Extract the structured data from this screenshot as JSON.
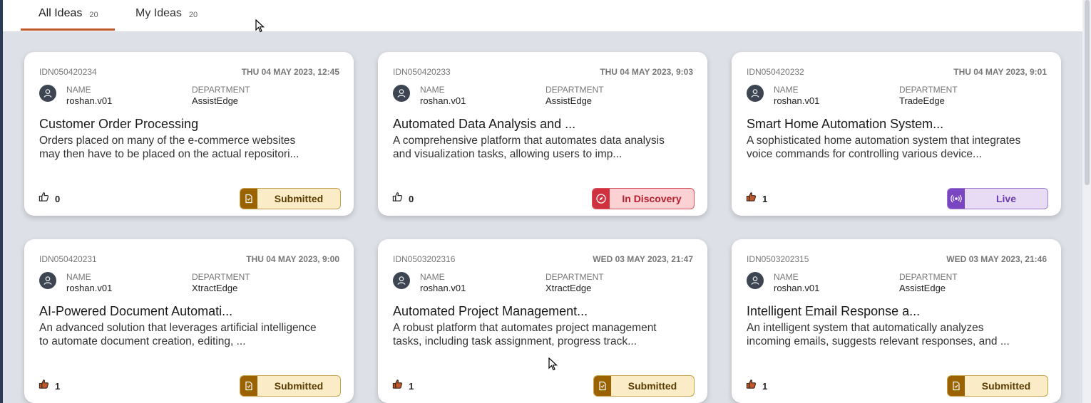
{
  "tabs": [
    {
      "label": "All Ideas",
      "count": "20",
      "active": true
    },
    {
      "label": "My Ideas",
      "count": "20",
      "active": false
    }
  ],
  "labels": {
    "name": "NAME",
    "department": "DEPARTMENT"
  },
  "cards": [
    {
      "id": "IDN050420234",
      "date": "THU 04 MAY 2023, 12:45",
      "name": "roshan.v01",
      "department": "AssistEdge",
      "title": "Customer Order Processing",
      "desc1": "Orders placed on many of the e-commerce websites",
      "desc2": "may then have to be placed on the actual repositori...",
      "likes": "0",
      "liked": false,
      "status": "Submitted",
      "status_type": "submitted"
    },
    {
      "id": "IDN050420233",
      "date": "THU 04 MAY 2023, 9:03",
      "name": "roshan.v01",
      "department": "AssistEdge",
      "title": "Automated Data Analysis and ...",
      "desc1": "A comprehensive platform that automates data analysis",
      "desc2": "and visualization tasks, allowing users to imp...",
      "likes": "0",
      "liked": false,
      "status": "In Discovery",
      "status_type": "discovery"
    },
    {
      "id": "IDN050420232",
      "date": "THU 04 MAY 2023, 9:01",
      "name": "roshan.v01",
      "department": "TradeEdge",
      "title": "Smart Home Automation System...",
      "desc1": "A sophisticated home automation system that integrates",
      "desc2": "voice commands for controlling various device...",
      "likes": "1",
      "liked": true,
      "status": "Live",
      "status_type": "live"
    },
    {
      "id": "IDN050420231",
      "date": "THU 04 MAY 2023, 9:00",
      "name": "roshan.v01",
      "department": "XtractEdge",
      "title": "AI-Powered Document Automati...",
      "desc1": "An advanced solution that leverages artificial intelligence",
      "desc2": "to automate document creation, editing, ...",
      "likes": "1",
      "liked": true,
      "status": "Submitted",
      "status_type": "submitted"
    },
    {
      "id": "IDN0503202316",
      "date": "WED 03 MAY 2023, 21:47",
      "name": "roshan.v01",
      "department": "XtractEdge",
      "title": "Automated Project Management...",
      "desc1": "A robust platform that automates project management",
      "desc2": "tasks, including task assignment, progress track...",
      "likes": "1",
      "liked": true,
      "status": "Submitted",
      "status_type": "submitted"
    },
    {
      "id": "IDN0503202315",
      "date": "WED 03 MAY 2023, 21:46",
      "name": "roshan.v01",
      "department": "AssistEdge",
      "title": "Intelligent Email Response a...",
      "desc1": "An intelligent system that automatically analyzes",
      "desc2": "incoming emails, suggests relevant responses, and ...",
      "likes": "1",
      "liked": true,
      "status": "Submitted",
      "status_type": "submitted"
    }
  ],
  "colors": {
    "tab_underline": "#c0582a",
    "submitted": "#9a6200",
    "in_discovery": "#d0313f",
    "live": "#7a45c0",
    "liked": "#c0582a"
  }
}
